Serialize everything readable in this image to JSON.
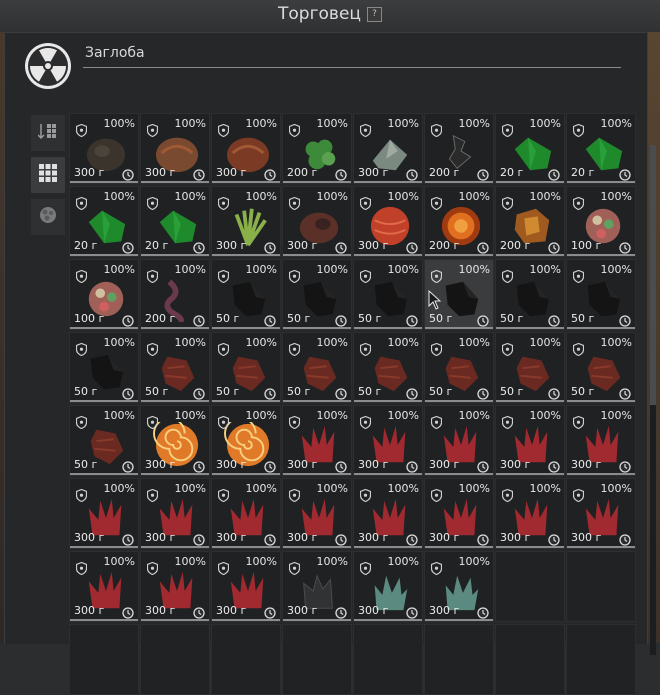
{
  "window": {
    "title": "Торговец",
    "help_label": "?"
  },
  "search": {
    "value": "Заглоба"
  },
  "colors": {
    "price_bar": "#8a8c8e",
    "panel": "#252729"
  },
  "sidebar": {
    "items": [
      {
        "name": "sort-icon",
        "active": false
      },
      {
        "name": "grid-view-icon",
        "active": true
      },
      {
        "name": "artifact-icon",
        "active": false
      }
    ]
  },
  "items": [
    {
      "cond": "100%",
      "price": "300 г",
      "art": "dark-rock",
      "color": "#3a342c"
    },
    {
      "cond": "100%",
      "price": "300 г",
      "art": "meat",
      "color": "#7a4a30"
    },
    {
      "cond": "100%",
      "price": "300 г",
      "art": "meat",
      "color": "#7a3a24"
    },
    {
      "cond": "100%",
      "price": "200 г",
      "art": "green-cluster",
      "color": "#3c8a3a"
    },
    {
      "cond": "100%",
      "price": "300 г",
      "art": "gray-crystal",
      "color": "#7a8a80"
    },
    {
      "cond": "100%",
      "price": "200 г",
      "art": "black-shards",
      "color": "#2a2a2a"
    },
    {
      "cond": "100%",
      "price": "20 г",
      "art": "green-leaf",
      "color": "#1f8a2c"
    },
    {
      "cond": "100%",
      "price": "20 г",
      "art": "green-leaf",
      "color": "#1f8a2c"
    },
    {
      "cond": "100%",
      "price": "20 г",
      "art": "green-leaf",
      "color": "#1f8a2c"
    },
    {
      "cond": "100%",
      "price": "20 г",
      "art": "green-leaf",
      "color": "#1f8a2c"
    },
    {
      "cond": "100%",
      "price": "300 г",
      "art": "green-sprout",
      "color": "#8ab04a"
    },
    {
      "cond": "100%",
      "price": "300 г",
      "art": "meat-dark",
      "color": "#5a3028"
    },
    {
      "cond": "100%",
      "price": "300 г",
      "art": "red-orb",
      "color": "#c0402a"
    },
    {
      "cond": "100%",
      "price": "200 г",
      "art": "fire-orb",
      "color": "#e07020"
    },
    {
      "cond": "100%",
      "price": "200 г",
      "art": "amber",
      "color": "#a05a20"
    },
    {
      "cond": "100%",
      "price": "100 г",
      "art": "flower",
      "color": "#a06058"
    },
    {
      "cond": "100%",
      "price": "100 г",
      "art": "flower",
      "color": "#a06058"
    },
    {
      "cond": "100%",
      "price": "200 г",
      "art": "purple-vine",
      "color": "#6a3a4a"
    },
    {
      "cond": "100%",
      "price": "50 г",
      "art": "black-stone",
      "color": "#141414"
    },
    {
      "cond": "100%",
      "price": "50 г",
      "art": "black-stone",
      "color": "#141414"
    },
    {
      "cond": "100%",
      "price": "50 г",
      "art": "black-stone",
      "color": "#141414"
    },
    {
      "cond": "100%",
      "price": "50 г",
      "art": "black-stone",
      "color": "#141414",
      "hover": true
    },
    {
      "cond": "100%",
      "price": "50 г",
      "art": "black-stone",
      "color": "#141414"
    },
    {
      "cond": "100%",
      "price": "50 г",
      "art": "black-stone",
      "color": "#141414"
    },
    {
      "cond": "100%",
      "price": "50 г",
      "art": "black-stone",
      "color": "#141414"
    },
    {
      "cond": "100%",
      "price": "50 г",
      "art": "meat-chunk",
      "color": "#6a2a22"
    },
    {
      "cond": "100%",
      "price": "50 г",
      "art": "meat-chunk",
      "color": "#6a2a22"
    },
    {
      "cond": "100%",
      "price": "50 г",
      "art": "meat-chunk",
      "color": "#6a2a22"
    },
    {
      "cond": "100%",
      "price": "50 г",
      "art": "meat-chunk",
      "color": "#6a2a22"
    },
    {
      "cond": "100%",
      "price": "50 г",
      "art": "meat-chunk",
      "color": "#6a2a22"
    },
    {
      "cond": "100%",
      "price": "50 г",
      "art": "meat-chunk",
      "color": "#6a2a22"
    },
    {
      "cond": "100%",
      "price": "50 г",
      "art": "meat-chunk",
      "color": "#6a2a22"
    },
    {
      "cond": "100%",
      "price": "50 г",
      "art": "meat-chunk",
      "color": "#6a2a22"
    },
    {
      "cond": "100%",
      "price": "300 г",
      "art": "spiral",
      "color": "#e07a28"
    },
    {
      "cond": "100%",
      "price": "300 г",
      "art": "spiral",
      "color": "#e07a28"
    },
    {
      "cond": "100%",
      "price": "300 г",
      "art": "red-crystal",
      "color": "#a02a30"
    },
    {
      "cond": "100%",
      "price": "300 г",
      "art": "red-crystal",
      "color": "#a02a30"
    },
    {
      "cond": "100%",
      "price": "300 г",
      "art": "red-crystal",
      "color": "#a02a30"
    },
    {
      "cond": "100%",
      "price": "300 г",
      "art": "red-crystal",
      "color": "#a02a30"
    },
    {
      "cond": "100%",
      "price": "300 г",
      "art": "red-crystal",
      "color": "#a02a30"
    },
    {
      "cond": "100%",
      "price": "300 г",
      "art": "red-crystal",
      "color": "#a02a30"
    },
    {
      "cond": "100%",
      "price": "300 г",
      "art": "red-crystal",
      "color": "#a02a30"
    },
    {
      "cond": "100%",
      "price": "300 г",
      "art": "red-crystal",
      "color": "#a02a30"
    },
    {
      "cond": "100%",
      "price": "300 г",
      "art": "red-crystal",
      "color": "#a02a30"
    },
    {
      "cond": "100%",
      "price": "300 г",
      "art": "red-crystal",
      "color": "#a02a30"
    },
    {
      "cond": "100%",
      "price": "300 г",
      "art": "red-crystal",
      "color": "#a02a30"
    },
    {
      "cond": "100%",
      "price": "300 г",
      "art": "red-crystal",
      "color": "#a02a30"
    },
    {
      "cond": "100%",
      "price": "300 г",
      "art": "red-crystal",
      "color": "#a02a30"
    },
    {
      "cond": "100%",
      "price": "300 г",
      "art": "red-crystal",
      "color": "#a02a30"
    },
    {
      "cond": "100%",
      "price": "300 г",
      "art": "red-crystal",
      "color": "#a02a30"
    },
    {
      "cond": "100%",
      "price": "300 г",
      "art": "red-crystal",
      "color": "#a02a30"
    },
    {
      "cond": "100%",
      "price": "300 г",
      "art": "dark-crystal",
      "color": "#303234"
    },
    {
      "cond": "100%",
      "price": "300 г",
      "art": "teal-crystal",
      "color": "#5a8a80"
    },
    {
      "cond": "100%",
      "price": "300 г",
      "art": "teal-crystal",
      "color": "#5a8a80"
    }
  ]
}
